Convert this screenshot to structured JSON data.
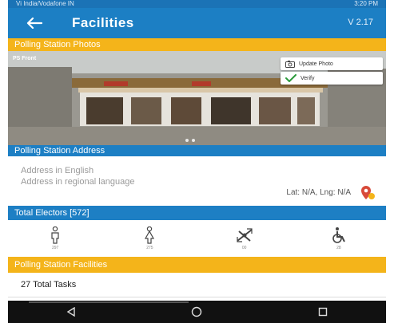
{
  "status_bar": {
    "carrier": "Vi India/Vodafone IN",
    "right": "3:20 PM"
  },
  "header": {
    "title": "Facilities",
    "version": "V 2.17"
  },
  "photos": {
    "header": "Polling Station Photos",
    "photo_label": "PS Front",
    "update_label": "Update Photo",
    "verify_label": "Verify"
  },
  "address": {
    "header": "Polling Station Address",
    "english_placeholder": "Address in English",
    "regional_placeholder": "Address in regional language",
    "latlng": "Lat: N/A, Lng: N/A"
  },
  "electors": {
    "header": "Total Electors [572]",
    "items": [
      {
        "icon": "male-icon",
        "count": "297"
      },
      {
        "icon": "female-icon",
        "count": "275"
      },
      {
        "icon": "third-gender-icon",
        "count": "00"
      },
      {
        "icon": "pwd-icon",
        "count": "28"
      }
    ]
  },
  "facilities": {
    "header": "Polling Station Facilities",
    "tasks_text": "27 Total Tasks"
  },
  "colors": {
    "app_bar": "#1c7fc4",
    "section_yellow": "#f4b41a",
    "section_blue": "#1d7fc4",
    "nav_bar": "#111111"
  }
}
